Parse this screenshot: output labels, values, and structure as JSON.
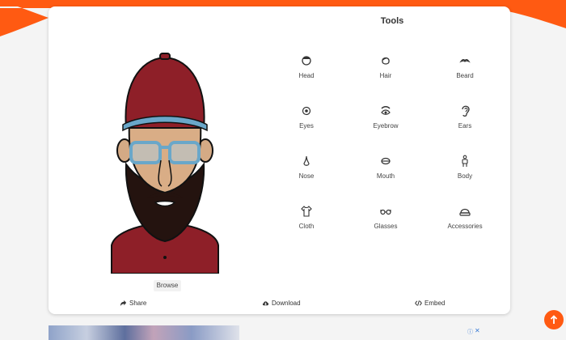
{
  "colors": {
    "accent": "#ff5a12",
    "card": "#ffffff",
    "background": "#f4f4f4"
  },
  "panel": {
    "title": "Tools"
  },
  "tools": [
    {
      "label": "Head",
      "icon": "head-icon"
    },
    {
      "label": "Hair",
      "icon": "hair-icon"
    },
    {
      "label": "Beard",
      "icon": "beard-icon"
    },
    {
      "label": "Eyes",
      "icon": "eye-icon"
    },
    {
      "label": "Eyebrow",
      "icon": "eyebrow-icon"
    },
    {
      "label": "Ears",
      "icon": "ear-icon"
    },
    {
      "label": "Nose",
      "icon": "nose-icon"
    },
    {
      "label": "Mouth",
      "icon": "mouth-icon"
    },
    {
      "label": "Body",
      "icon": "body-icon"
    },
    {
      "label": "Cloth",
      "icon": "cloth-icon"
    },
    {
      "label": "Glasses",
      "icon": "glasses-icon"
    },
    {
      "label": "Accessories",
      "icon": "accessories-icon"
    }
  ],
  "avatar": {
    "browse_label": "Browse"
  },
  "actions": {
    "share": "Share",
    "download": "Download",
    "embed": "Embed"
  },
  "ad": {
    "info_mark": "ⓘ",
    "close_mark": "✕"
  }
}
